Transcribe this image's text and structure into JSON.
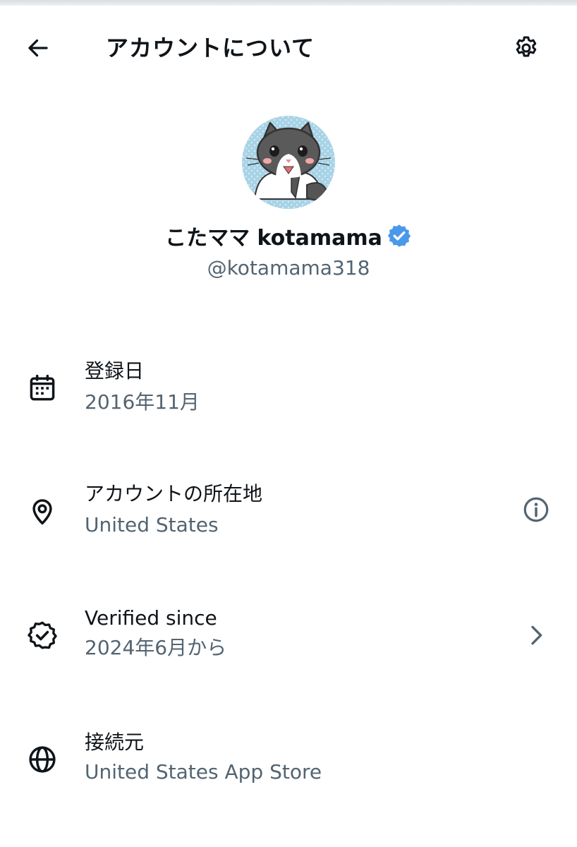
{
  "header": {
    "title": "アカウントについて",
    "back_icon": "arrow-left-icon",
    "settings_icon": "gear-icon"
  },
  "profile": {
    "display_name": "こたママ kotamama",
    "handle": "@kotamama318",
    "verified": true,
    "verified_color": "#4a99e9",
    "avatar": "cat-avatar-icon"
  },
  "rows": [
    {
      "icon": "calendar-icon",
      "title": "登録日",
      "value": "2016年11月"
    },
    {
      "icon": "location-pin-icon",
      "title": "アカウントの所在地",
      "value": "United States",
      "action_icon": "info-circle-icon"
    },
    {
      "icon": "verified-badge-outline-icon",
      "title": "Verified since",
      "value": "2024年6月から",
      "action_icon": "chevron-right-icon"
    },
    {
      "icon": "globe-icon",
      "title": "接続元",
      "value": "United States App Store"
    }
  ],
  "colors": {
    "primary_text": "#0f1419",
    "secondary_text": "#536471",
    "background": "#ffffff"
  }
}
